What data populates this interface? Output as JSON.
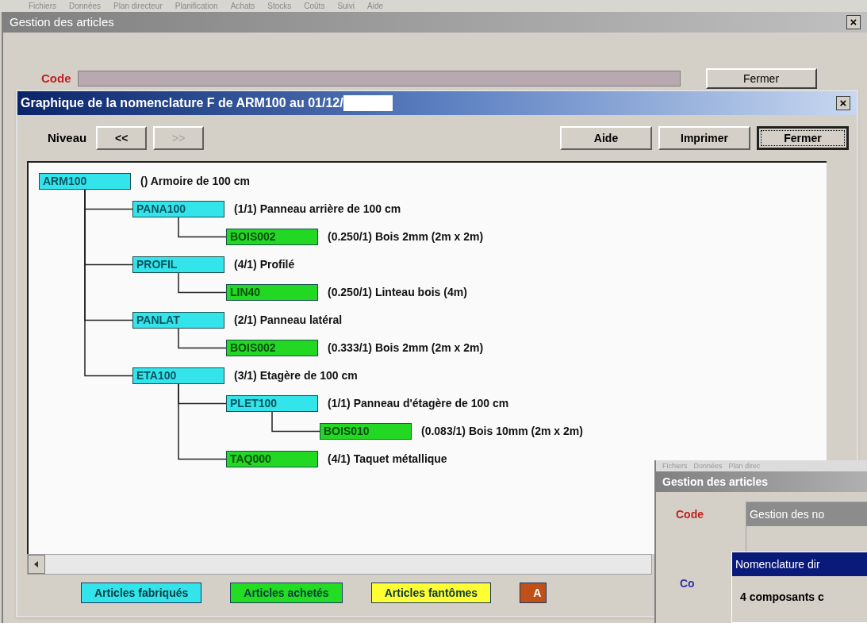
{
  "menu": [
    "Fichiers",
    "Données",
    "Plan directeur",
    "Planification",
    "Achats",
    "Stocks",
    "Coûts",
    "Suivi",
    "Aide"
  ],
  "main_window": {
    "title": "Gestion des articles",
    "close": "×",
    "code_label": "Code",
    "close_button": "Fermer"
  },
  "dialog": {
    "title": "Graphique de la nomenclature F de ARM100 au 01/12/",
    "close": "×",
    "level_label": "Niveau",
    "nav_buttons": [
      {
        "label": "<<",
        "disabled": false
      },
      {
        "label": ">>",
        "disabled": true
      }
    ],
    "buttons": [
      {
        "label": "Aide",
        "default": false
      },
      {
        "label": "Imprimer",
        "default": false
      },
      {
        "label": "Fermer",
        "default": true
      }
    ],
    "tree": [
      {
        "code": "ARM100",
        "text": "() Armoire de 100 cm",
        "kind": "fabrique",
        "children": [
          {
            "code": "PANA100",
            "text": "(1/1) Panneau arrière de 100 cm",
            "kind": "fabrique",
            "children": [
              {
                "code": "BOIS002",
                "text": "(0.250/1) Bois 2mm (2m x 2m)",
                "kind": "achete"
              }
            ]
          },
          {
            "code": "PROFIL",
            "text": "(4/1) Profilé",
            "kind": "fabrique",
            "children": [
              {
                "code": "LIN40",
                "text": "(0.250/1) Linteau bois  (4m)",
                "kind": "achete"
              }
            ]
          },
          {
            "code": "PANLAT",
            "text": "(2/1) Panneau latéral",
            "kind": "fabrique",
            "children": [
              {
                "code": "BOIS002",
                "text": "(0.333/1) Bois 2mm (2m x 2m)",
                "kind": "achete"
              }
            ]
          },
          {
            "code": "ETA100",
            "text": "(3/1) Etagère de 100 cm",
            "kind": "fabrique",
            "children": [
              {
                "code": "PLET100",
                "text": "(1/1) Panneau d'étagère de 100 cm",
                "kind": "fabrique",
                "children": [
                  {
                    "code": "BOIS010",
                    "text": "(0.083/1) Bois 10mm (2m x 2m)",
                    "kind": "achete"
                  }
                ]
              },
              {
                "code": "TAQ000",
                "text": "(4/1) Taquet métallique",
                "kind": "achete"
              }
            ]
          }
        ]
      }
    ],
    "legend": [
      {
        "label": "Articles fabriqués",
        "color": "#33e4ea"
      },
      {
        "label": "Articles achetés",
        "color": "#22dd22"
      },
      {
        "label": "Articles fantômes",
        "color": "#ffff33"
      },
      {
        "label": "A",
        "color": "#c0501a"
      }
    ]
  },
  "overlay": {
    "menu": [
      "Fichiers",
      "Données",
      "Plan direc"
    ],
    "title": "Gestion des articles",
    "code_label": "Code",
    "inner_title": "Gestion des no",
    "sub_title": "Nomenclature dir",
    "sub_code_label": "Co",
    "summary": "4 composants c"
  }
}
